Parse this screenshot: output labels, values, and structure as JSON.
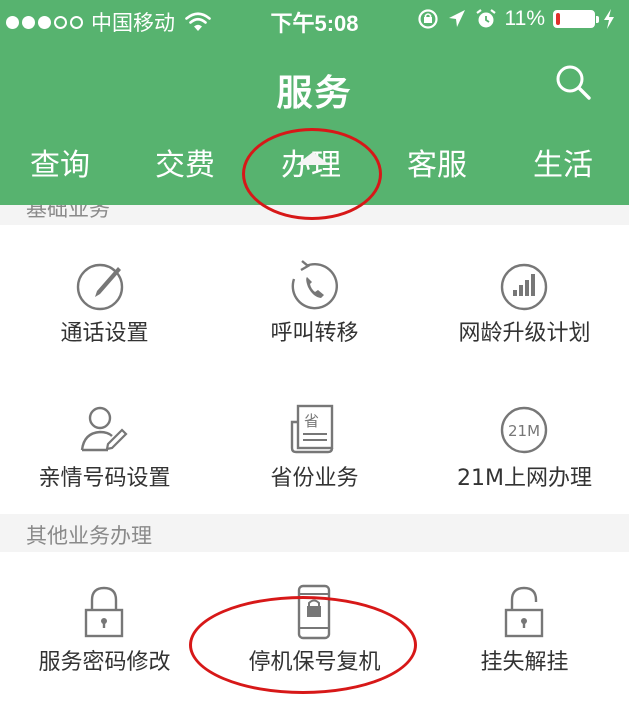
{
  "status_bar": {
    "carrier": "中国移动",
    "time": "下午5:08",
    "battery_percent": "11%",
    "battery_level": 0.11,
    "signal_dots_filled": 3,
    "signal_dots_total": 5
  },
  "header": {
    "title": "服务",
    "search_icon": "search-icon"
  },
  "tabs": [
    {
      "label": "查询"
    },
    {
      "label": "交费"
    },
    {
      "label": "办理",
      "active": true
    },
    {
      "label": "客服"
    },
    {
      "label": "生活"
    }
  ],
  "sections": [
    {
      "header": "基础业务",
      "items": [
        {
          "label": "通话设置",
          "icon": "pen-icon"
        },
        {
          "label": "呼叫转移",
          "icon": "call-forward-icon"
        },
        {
          "label": "网龄升级计划",
          "icon": "signal-bars-icon"
        },
        {
          "label": "亲情号码设置",
          "icon": "user-edit-icon"
        },
        {
          "label": "省份业务",
          "icon": "province-doc-icon"
        },
        {
          "label": "21M上网办理",
          "icon": "21m-icon",
          "badge": "21M"
        }
      ]
    },
    {
      "header": "其他业务办理",
      "items": [
        {
          "label": "服务密码修改",
          "icon": "lock-icon"
        },
        {
          "label": "停机保号复机",
          "icon": "phone-lock-icon"
        },
        {
          "label": "挂失解挂",
          "icon": "unlock-icon"
        }
      ]
    }
  ],
  "doc_glyph": "省",
  "colors": {
    "header_bg": "#57b36f",
    "annotation": "#d71818",
    "battery_low": "#e0302b"
  }
}
